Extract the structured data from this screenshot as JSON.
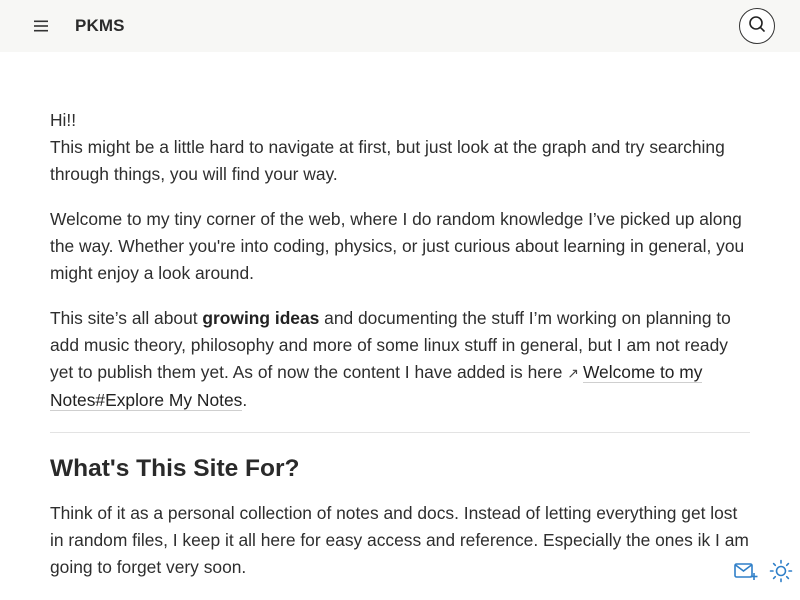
{
  "header": {
    "site_title": "PKMS",
    "menu_icon": "hamburger-menu-icon",
    "search_icon": "search-icon"
  },
  "intro": {
    "greeting": "Hi!!",
    "line1": "This might be a little hard to navigate at first, but just look at the graph and try searching through things, you will find your way."
  },
  "welcome": {
    "text": "Welcome to my tiny corner of the web, where I do random knowledge I’ve picked up along the way. Whether you're into coding, physics, or just curious about learning in general, you might enjoy a look around."
  },
  "about": {
    "before_bold": "This site’s all about ",
    "bold": "growing ideas",
    "after_bold": " and documenting the stuff I’m working on planning to add music theory, philosophy and more of some linux stuff in general, but I am not ready yet to publish them yet. As of now the content I have added is here ",
    "link_label": "Welcome to my Notes#Explore My Notes",
    "link_suffix": "."
  },
  "section": {
    "heading": "What's This Site For?",
    "paragraph": "Think of it as a personal collection of notes and docs. Instead of letting everything get lost in random files, I keep it all here for easy access and reference. Especially the ones ik I am going to forget very soon."
  },
  "floating_buttons": {
    "mail_icon": "mail-plus-icon",
    "theme_icon": "sun-theme-icon",
    "accent_color": "#2f7fc8"
  }
}
